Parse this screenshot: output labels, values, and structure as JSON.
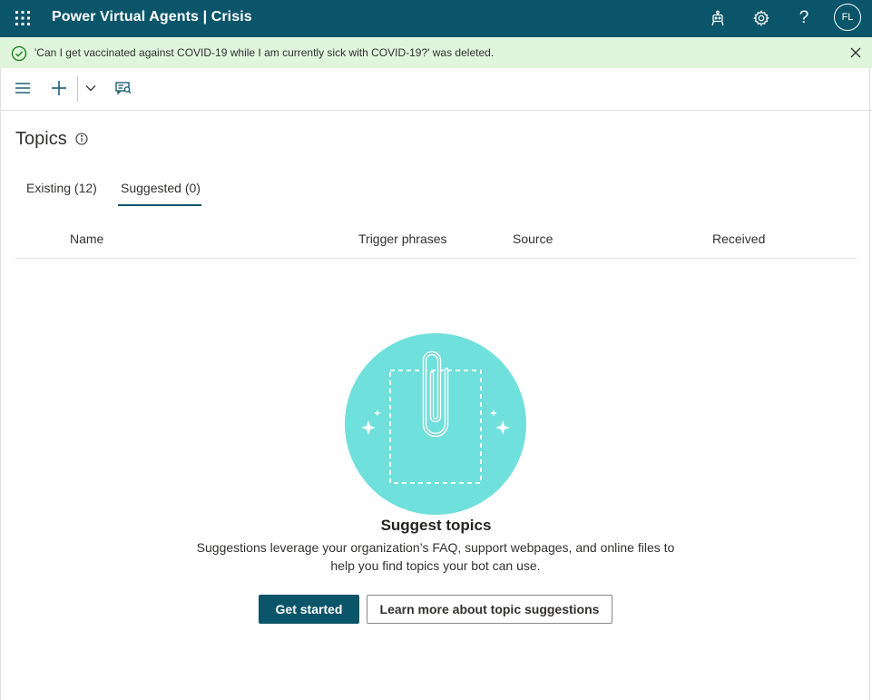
{
  "header": {
    "app_title": "Power Virtual Agents | Crisis",
    "avatar_initials": "FL",
    "background_color": "#0b556a",
    "icons": [
      "waffle-icon",
      "bot-icon",
      "gear-icon",
      "help-icon"
    ]
  },
  "notification": {
    "message": "'Can I get vaccinated against COVID-19 while I am currently sick with COVID-19?' was deleted.",
    "background_color": "#dff6dd",
    "status_icon": "check-circle-icon"
  },
  "toolbar": {
    "icons": [
      "hamburger-menu-icon",
      "add-icon",
      "chevron-down-icon",
      "topics-suggest-icon"
    ]
  },
  "page": {
    "title": "Topics",
    "tabs": [
      {
        "label": "Existing (12)",
        "selected": false
      },
      {
        "label": "Suggested (0)",
        "selected": true
      }
    ]
  },
  "table": {
    "columns": [
      "Name",
      "Trigger phrases",
      "Source",
      "Received"
    ],
    "rows": []
  },
  "empty_state": {
    "title": "Suggest topics",
    "description_line1": "Suggestions leverage your organization’s FAQ, support webpages, and online files to",
    "description_line2": "help you find topics your bot can use.",
    "primary_button": "Get started",
    "secondary_button": "Learn more about topic suggestions",
    "illustration_color": "#6fe0dc"
  }
}
